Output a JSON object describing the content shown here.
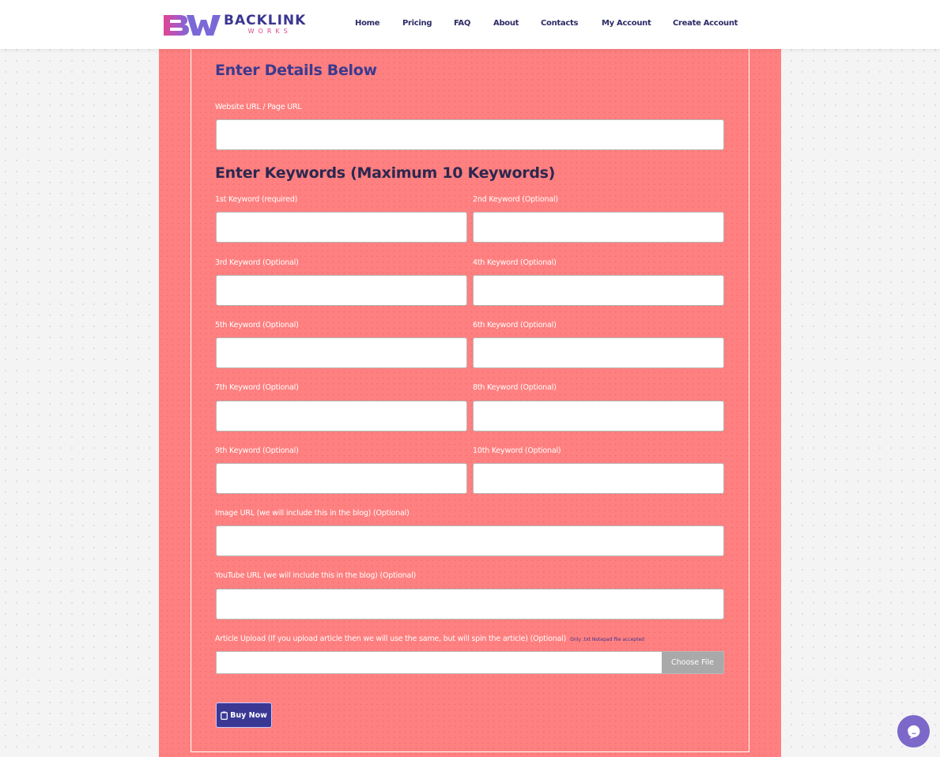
{
  "brand": {
    "name": "BACKLINK",
    "subname": "WORKS",
    "colors": {
      "primary": "#3b3690",
      "accent": "#d9468f",
      "panel": "#ff8080",
      "button": "#3b3894",
      "chat": "#7b68c9"
    }
  },
  "nav": {
    "items": [
      {
        "label": "Home"
      },
      {
        "label": "Pricing"
      },
      {
        "label": "FAQ"
      },
      {
        "label": "About"
      },
      {
        "label": "Contacts"
      },
      {
        "label": "My Account"
      },
      {
        "label": "Create Account"
      }
    ]
  },
  "form": {
    "details_heading": "Enter Details Below",
    "website": {
      "label": "Website URL / Page URL",
      "value": ""
    },
    "keywords_heading": "Enter Keywords (Maximum 10 Keywords)",
    "keywords": [
      {
        "label": "1st Keyword (required)",
        "value": ""
      },
      {
        "label": "2nd Keyword (Optional)",
        "value": ""
      },
      {
        "label": "3rd Keyword (Optional)",
        "value": ""
      },
      {
        "label": "4th Keyword (Optional)",
        "value": ""
      },
      {
        "label": "5th Keyword (Optional)",
        "value": ""
      },
      {
        "label": "6th Keyword (Optional)",
        "value": ""
      },
      {
        "label": "7th Keyword (Optional)",
        "value": ""
      },
      {
        "label": "8th Keyword (Optional)",
        "value": ""
      },
      {
        "label": "9th Keyword (Optional)",
        "value": ""
      },
      {
        "label": "10th Keyword (Optional)",
        "value": ""
      }
    ],
    "image_url": {
      "label": "Image URL (we will include this in the blog) (Optional)",
      "value": ""
    },
    "youtube_url": {
      "label": "YouTube URL (we will include this in the blog) (Optional)",
      "value": ""
    },
    "article_upload": {
      "label": "Article Upload (If you upload article then we will use the same, but will spin the article) (Optional)",
      "note": "Only .txt Notepad file accepted",
      "button_label": "Choose File"
    },
    "buy_button": {
      "icon": "clipboard-icon",
      "label": "Buy Now"
    }
  },
  "chat_widget": {
    "icon": "chat-bubble-icon"
  }
}
